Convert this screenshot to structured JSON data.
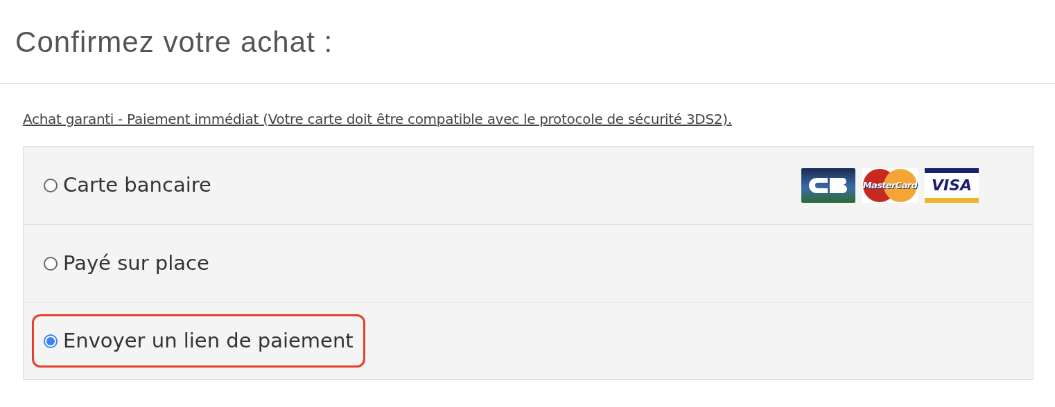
{
  "title": "Confirmez votre achat :",
  "notice_link": "Achat garanti - Paiement immédiat (Votre carte doit être compatible avec le protocole de sécurité 3DS2).",
  "options": [
    {
      "label": "Carte bancaire",
      "selected": false,
      "highlighted": false,
      "logos": [
        {
          "kind": "cb"
        },
        {
          "kind": "mastercard",
          "text": "MasterCard"
        },
        {
          "kind": "visa",
          "text": "VISA"
        }
      ]
    },
    {
      "label": "Payé sur place",
      "selected": false,
      "highlighted": false
    },
    {
      "label": "Envoyer un lien de paiement",
      "selected": true,
      "highlighted": true
    }
  ]
}
